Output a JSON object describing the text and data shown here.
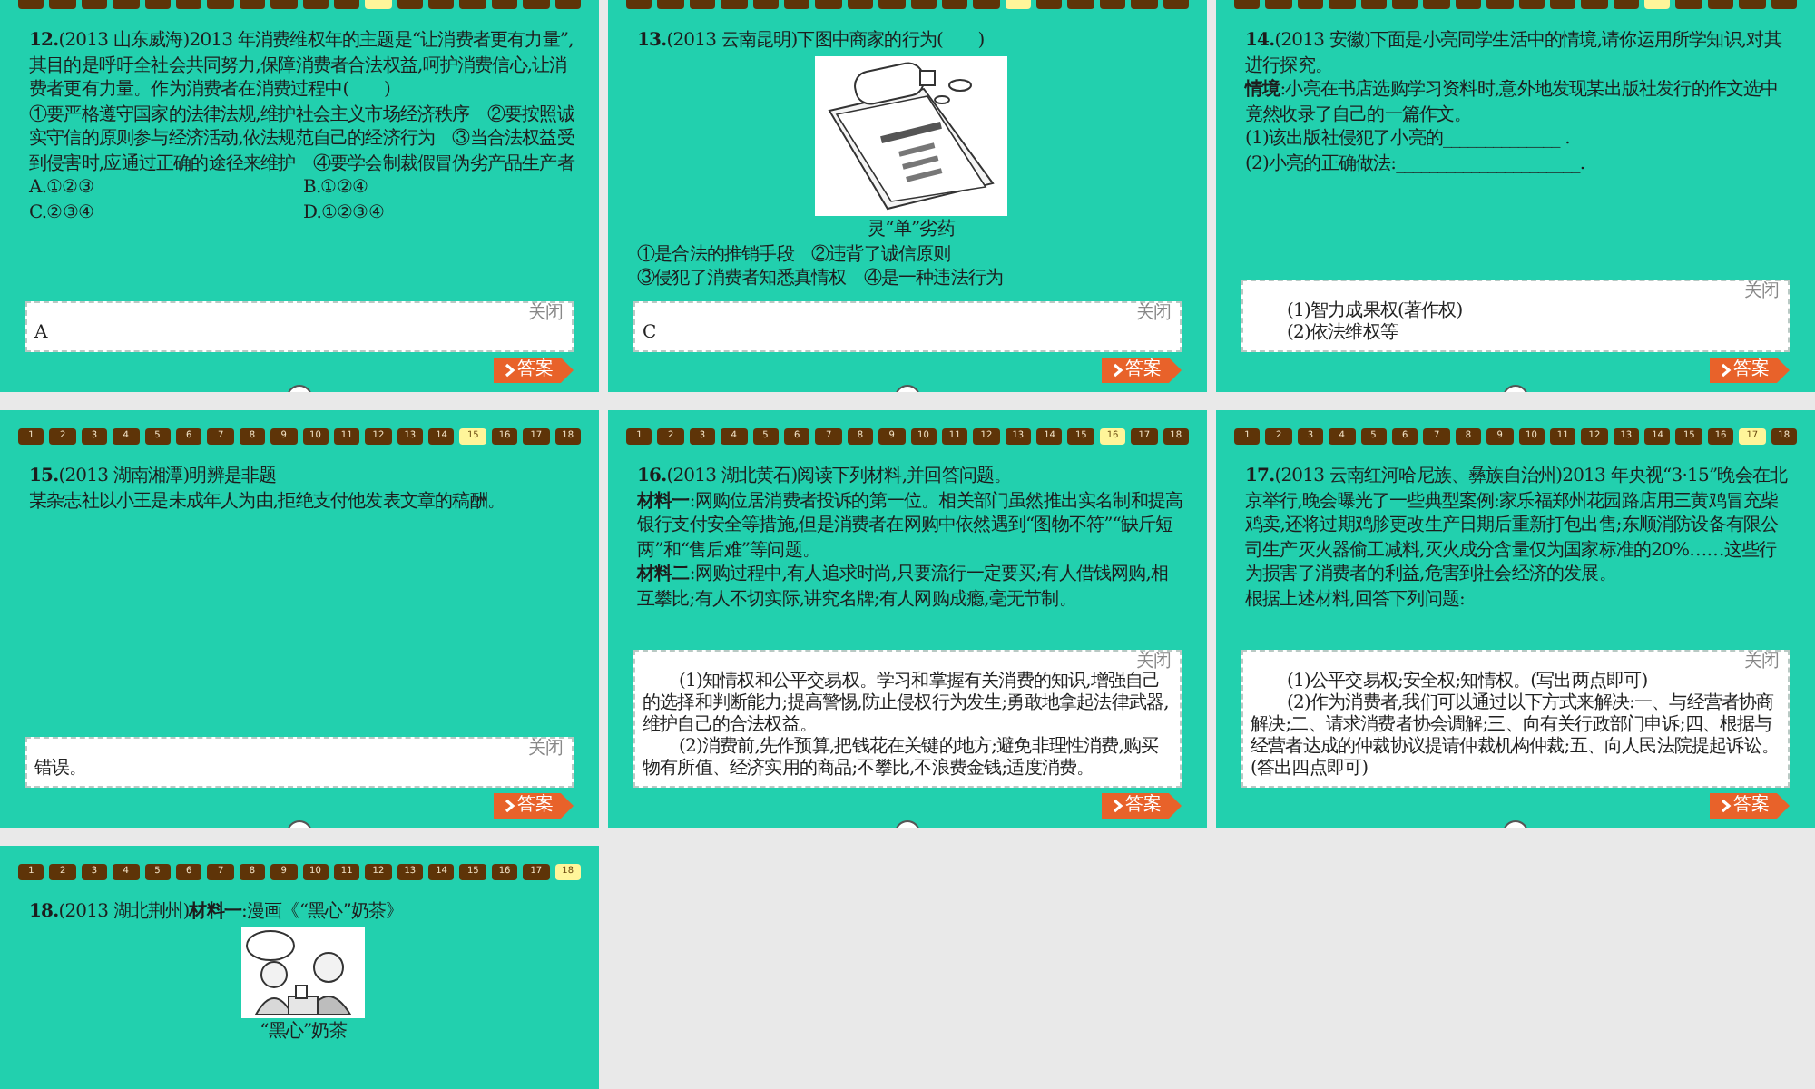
{
  "slides": [
    {
      "nav": [
        {
          "selected": false
        },
        {
          "selected": false
        },
        {
          "selected": false
        },
        {
          "selected": false
        },
        {
          "selected": false
        },
        {
          "selected": false
        },
        {
          "selected": false
        },
        {
          "selected": false
        },
        {
          "selected": false
        },
        {
          "selected": false
        },
        {
          "selected": false
        },
        {
          "selected": true
        },
        {
          "selected": false
        },
        {
          "selected": false
        },
        {
          "selected": false
        },
        {
          "selected": false
        },
        {
          "selected": false
        },
        {
          "selected": false
        }
      ],
      "content": [
        {
          "kind": "text",
          "text": "**12.**(2013 山东威海)2013 年消费维权年的主题是“让消费者更有力量”,其目的是呼吁全社会共同努力,保障消费者合法权益,呵护消费信心,让消费者更有力量。作为消费者在消费过程中(　　)"
        },
        {
          "kind": "text",
          "text": "①要严格遵守国家的法律法规,维护社会主义市场经济秩序　②要按照诚实守信的原则参与经济活动,依法规范自己的经济行为　③当合法权益受到侵害时,应通过正确的途径来维护　④要学会制裁假冒伪劣产品生产者"
        },
        {
          "kind": "options",
          "items": [
            "A.①②③",
            "B.①②④",
            "C.②③④",
            "D.①②③④"
          ]
        }
      ],
      "answer": {
        "close": "关闭",
        "lines": [
          "A"
        ],
        "indent": false
      },
      "answer_button": "答案"
    },
    {
      "nav": [
        {
          "selected": false
        },
        {
          "selected": false
        },
        {
          "selected": false
        },
        {
          "selected": false
        },
        {
          "selected": false
        },
        {
          "selected": false
        },
        {
          "selected": false
        },
        {
          "selected": false
        },
        {
          "selected": false
        },
        {
          "selected": false
        },
        {
          "selected": false
        },
        {
          "selected": false
        },
        {
          "selected": true
        },
        {
          "selected": false
        },
        {
          "selected": false
        },
        {
          "selected": false
        },
        {
          "selected": false
        },
        {
          "selected": false
        }
      ],
      "content": [
        {
          "kind": "text",
          "text": "**13.**(2013 云南昆明)下图中商家的行为(　　)"
        },
        {
          "kind": "picture",
          "caption": "灵“单”劣药"
        },
        {
          "kind": "text",
          "text": "①是合法的推销手段　②违背了诚信原则"
        },
        {
          "kind": "text",
          "text": "③侵犯了消费者知悉真情权　④是一种违法行为"
        }
      ],
      "answer": {
        "close": "关闭",
        "lines": [
          "C"
        ],
        "indent": false
      },
      "answer_button": "答案"
    },
    {
      "nav": [
        {
          "selected": false
        },
        {
          "selected": false
        },
        {
          "selected": false
        },
        {
          "selected": false
        },
        {
          "selected": false
        },
        {
          "selected": false
        },
        {
          "selected": false
        },
        {
          "selected": false
        },
        {
          "selected": false
        },
        {
          "selected": false
        },
        {
          "selected": false
        },
        {
          "selected": false
        },
        {
          "selected": false
        },
        {
          "selected": true
        },
        {
          "selected": false
        },
        {
          "selected": false
        },
        {
          "selected": false
        },
        {
          "selected": false
        }
      ],
      "content": [
        {
          "kind": "text",
          "text": "**14.**(2013 安徽)下面是小亮同学生活中的情境,请你运用所学知识,对其进行探究。"
        },
        {
          "kind": "text",
          "text": "**情境**:小亮在书店选购学习资料时,意外地发现某出版社发行的作文选中竟然收录了自己的一篇作文。"
        },
        {
          "kind": "text",
          "text": "(1)该出版社侵犯了小亮的______________ ."
        },
        {
          "kind": "text",
          "text": "(2)小亮的正确做法:______________________."
        }
      ],
      "answer": {
        "close": "关闭",
        "lines": [
          "(1)智力成果权(著作权)",
          "(2)依法维权等"
        ],
        "indent": true
      },
      "answer_button": "答案"
    },
    {
      "nav": [
        {
          "label": "1",
          "selected": false
        },
        {
          "label": "2",
          "selected": false
        },
        {
          "label": "3",
          "selected": false
        },
        {
          "label": "4",
          "selected": false
        },
        {
          "label": "5",
          "selected": false
        },
        {
          "label": "6",
          "selected": false
        },
        {
          "label": "7",
          "selected": false
        },
        {
          "label": "8",
          "selected": false
        },
        {
          "label": "9",
          "selected": false
        },
        {
          "label": "10",
          "selected": false
        },
        {
          "label": "11",
          "selected": false
        },
        {
          "label": "12",
          "selected": false
        },
        {
          "label": "13",
          "selected": false
        },
        {
          "label": "14",
          "selected": false
        },
        {
          "label": "15",
          "selected": true
        },
        {
          "label": "16",
          "selected": false
        },
        {
          "label": "17",
          "selected": false
        },
        {
          "label": "18",
          "selected": false
        }
      ],
      "content": [
        {
          "kind": "text",
          "text": "**15.**(2013 湖南湘潭)明辨是非题"
        },
        {
          "kind": "text",
          "text": "某杂志社以小王是未成年人为由,拒绝支付他发表文章的稿酬。"
        }
      ],
      "answer": {
        "close": "关闭",
        "lines": [
          "错误。"
        ],
        "indent": false
      },
      "answer_button": "答案"
    },
    {
      "nav": [
        {
          "label": "1",
          "selected": false
        },
        {
          "label": "2",
          "selected": false
        },
        {
          "label": "3",
          "selected": false
        },
        {
          "label": "4",
          "selected": false
        },
        {
          "label": "5",
          "selected": false
        },
        {
          "label": "6",
          "selected": false
        },
        {
          "label": "7",
          "selected": false
        },
        {
          "label": "8",
          "selected": false
        },
        {
          "label": "9",
          "selected": false
        },
        {
          "label": "10",
          "selected": false
        },
        {
          "label": "11",
          "selected": false
        },
        {
          "label": "12",
          "selected": false
        },
        {
          "label": "13",
          "selected": false
        },
        {
          "label": "14",
          "selected": false
        },
        {
          "label": "15",
          "selected": false
        },
        {
          "label": "16",
          "selected": true
        },
        {
          "label": "17",
          "selected": false
        },
        {
          "label": "18",
          "selected": false
        }
      ],
      "content": [
        {
          "kind": "text",
          "text": "**16.**(2013 湖北黄石)阅读下列材料,并回答问题。"
        },
        {
          "kind": "text",
          "text": "**材料一**:网购位居消费者投诉的第一位。相关部门虽然推出实名制和提高银行支付安全等措施,但是消费者在网购中依然遇到“图物不符”“缺斤短两”和“售后难”等问题。"
        },
        {
          "kind": "text",
          "text": "**材料二**:网购过程中,有人追求时尚,只要流行一定要买;有人借钱网购,相互攀比;有人不切实际,讲究名牌;有人网购成瘾,毫无节制。"
        }
      ],
      "answer": {
        "close": "关闭",
        "lines": [
          "(1)知情权和公平交易权。学习和掌握有关消费的知识,增强自己的选择和判断能力;提高警惕,防止侵权行为发生;勇敢地拿起法律武器,维护自己的合法权益。",
          "(2)消费前,先作预算,把钱花在关键的地方;避免非理性消费,购买物有所值、经济实用的商品;不攀比,不浪费金钱;适度消费。"
        ],
        "indent": true
      },
      "answer_button": "答案"
    },
    {
      "nav": [
        {
          "label": "1",
          "selected": false
        },
        {
          "label": "2",
          "selected": false
        },
        {
          "label": "3",
          "selected": false
        },
        {
          "label": "4",
          "selected": false
        },
        {
          "label": "5",
          "selected": false
        },
        {
          "label": "6",
          "selected": false
        },
        {
          "label": "7",
          "selected": false
        },
        {
          "label": "8",
          "selected": false
        },
        {
          "label": "9",
          "selected": false
        },
        {
          "label": "10",
          "selected": false
        },
        {
          "label": "11",
          "selected": false
        },
        {
          "label": "12",
          "selected": false
        },
        {
          "label": "13",
          "selected": false
        },
        {
          "label": "14",
          "selected": false
        },
        {
          "label": "15",
          "selected": false
        },
        {
          "label": "16",
          "selected": false
        },
        {
          "label": "17",
          "selected": true
        },
        {
          "label": "18",
          "selected": false
        }
      ],
      "content": [
        {
          "kind": "text",
          "text": "**17.**(2013 云南红河哈尼族、彝族自治州)2013 年央视“3·15”晚会在北京举行,晚会曝光了一些典型案例:家乐福郑州花园路店用三黄鸡冒充柴鸡卖,还将过期鸡胗更改生产日期后重新打包出售;东顺消防设备有限公司生产灭火器偷工减料,灭火成分含量仅为国家标准的20%……这些行为损害了消费者的利益,危害到社会经济的发展。"
        },
        {
          "kind": "text",
          "text": "根据上述材料,回答下列问题:"
        }
      ],
      "answer": {
        "close": "关闭",
        "lines": [
          "(1)公平交易权;安全权;知情权。(写出两点即可)",
          "(2)作为消费者,我们可以通过以下方式来解决:一、与经营者协商解决;二、请求消费者协会调解;三、向有关行政部门申诉;四、根据与经营者达成的仲裁协议提请仲裁机构仲裁;五、向人民法院提起诉讼。(答出四点即可)"
        ],
        "indent": true
      },
      "answer_button": "答案"
    },
    {
      "nav": [
        {
          "label": "1",
          "selected": false
        },
        {
          "label": "2",
          "selected": false
        },
        {
          "label": "3",
          "selected": false
        },
        {
          "label": "4",
          "selected": false
        },
        {
          "label": "5",
          "selected": false
        },
        {
          "label": "6",
          "selected": false
        },
        {
          "label": "7",
          "selected": false
        },
        {
          "label": "8",
          "selected": false
        },
        {
          "label": "9",
          "selected": false
        },
        {
          "label": "10",
          "selected": false
        },
        {
          "label": "11",
          "selected": false
        },
        {
          "label": "12",
          "selected": false
        },
        {
          "label": "13",
          "selected": false
        },
        {
          "label": "14",
          "selected": false
        },
        {
          "label": "15",
          "selected": false
        },
        {
          "label": "16",
          "selected": false
        },
        {
          "label": "17",
          "selected": false
        },
        {
          "label": "18",
          "selected": true
        }
      ],
      "content": [
        {
          "kind": "text",
          "text": "**18.**(2013 湖北荆州)**材料一**:漫画《“黑心”奶茶》"
        },
        {
          "kind": "picture",
          "caption": "“黑心”奶茶"
        }
      ]
    }
  ]
}
